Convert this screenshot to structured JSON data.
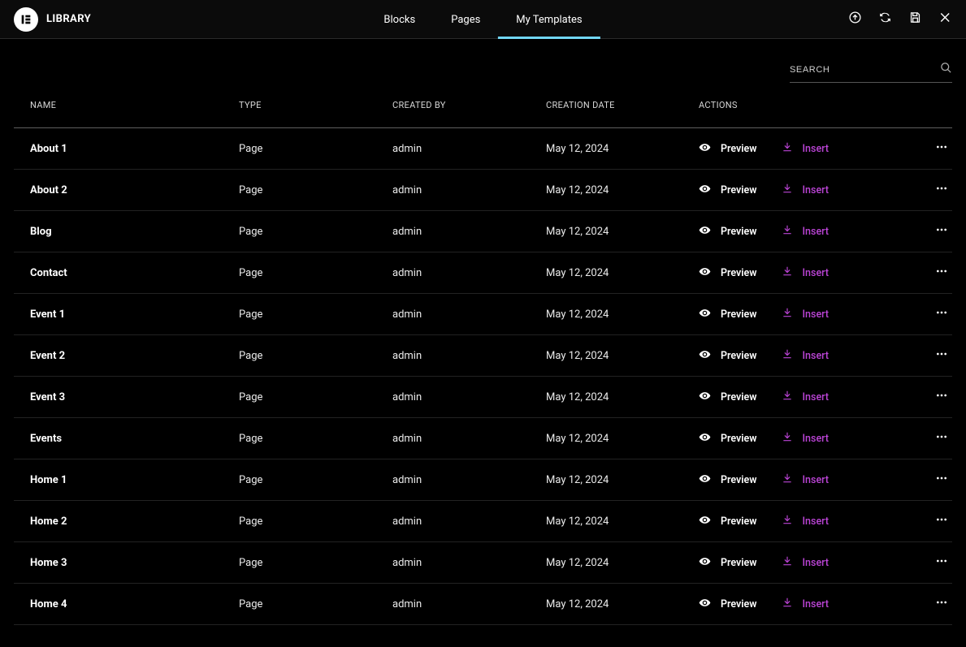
{
  "header": {
    "title": "LIBRARY",
    "tabs": [
      {
        "label": "Blocks",
        "active": false
      },
      {
        "label": "Pages",
        "active": false
      },
      {
        "label": "My Templates",
        "active": true
      }
    ],
    "icons": [
      "upload-icon",
      "sync-icon",
      "save-icon",
      "close-icon"
    ]
  },
  "search": {
    "placeholder": "SEARCH",
    "value": ""
  },
  "columns": {
    "name": "NAME",
    "type": "TYPE",
    "creator": "CREATED BY",
    "date": "CREATION DATE",
    "actions": "ACTIONS"
  },
  "actions": {
    "preview": "Preview",
    "insert": "Insert"
  },
  "colors": {
    "accent_cyan": "#71d7f7",
    "accent_purple": "#bb44d6",
    "background": "#000000",
    "row_border": "#222222"
  },
  "rows": [
    {
      "name": "About 1",
      "type": "Page",
      "creator": "admin",
      "date": "May 12, 2024"
    },
    {
      "name": "About 2",
      "type": "Page",
      "creator": "admin",
      "date": "May 12, 2024"
    },
    {
      "name": "Blog",
      "type": "Page",
      "creator": "admin",
      "date": "May 12, 2024"
    },
    {
      "name": "Contact",
      "type": "Page",
      "creator": "admin",
      "date": "May 12, 2024"
    },
    {
      "name": "Event 1",
      "type": "Page",
      "creator": "admin",
      "date": "May 12, 2024"
    },
    {
      "name": "Event 2",
      "type": "Page",
      "creator": "admin",
      "date": "May 12, 2024"
    },
    {
      "name": "Event 3",
      "type": "Page",
      "creator": "admin",
      "date": "May 12, 2024"
    },
    {
      "name": "Events",
      "type": "Page",
      "creator": "admin",
      "date": "May 12, 2024"
    },
    {
      "name": "Home 1",
      "type": "Page",
      "creator": "admin",
      "date": "May 12, 2024"
    },
    {
      "name": "Home 2",
      "type": "Page",
      "creator": "admin",
      "date": "May 12, 2024"
    },
    {
      "name": "Home 3",
      "type": "Page",
      "creator": "admin",
      "date": "May 12, 2024"
    },
    {
      "name": "Home 4",
      "type": "Page",
      "creator": "admin",
      "date": "May 12, 2024"
    }
  ]
}
